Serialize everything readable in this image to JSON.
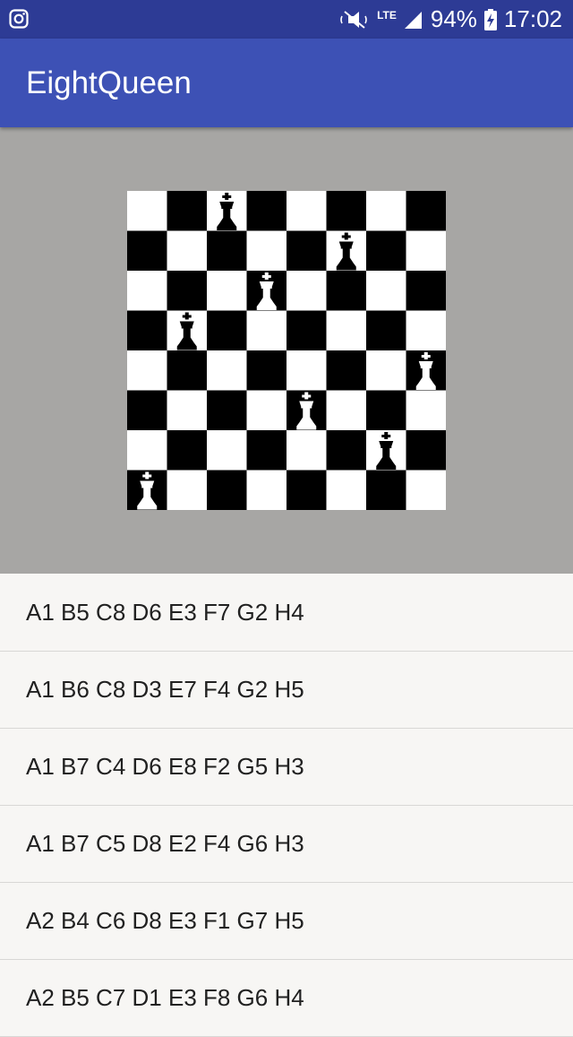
{
  "status_bar": {
    "battery": "94%",
    "time": "17:02",
    "network": "LTE",
    "icons": [
      "instagram-icon",
      "mute-icon",
      "signal-icon",
      "battery-charging-icon"
    ]
  },
  "app_bar": {
    "title": "EightQueen"
  },
  "board": {
    "size": 8,
    "queens": [
      {
        "col": 0,
        "row": 7,
        "color": "white"
      },
      {
        "col": 1,
        "row": 3,
        "color": "black"
      },
      {
        "col": 2,
        "row": 0,
        "color": "black"
      },
      {
        "col": 3,
        "row": 2,
        "color": "white"
      },
      {
        "col": 4,
        "row": 5,
        "color": "white"
      },
      {
        "col": 5,
        "row": 1,
        "color": "black"
      },
      {
        "col": 6,
        "row": 6,
        "color": "black"
      },
      {
        "col": 7,
        "row": 4,
        "color": "white"
      }
    ]
  },
  "solutions": [
    "A1 B5 C8 D6 E3 F7 G2 H4",
    "A1 B6 C8 D3 E7 F4 G2 H5",
    "A1 B7 C4 D6 E8 F2 G5 H3",
    "A1 B7 C5 D8 E2 F4 G6 H3",
    "A2 B4 C6 D8 E3 F1 G7 H5",
    "A2 B5 C7 D1 E3 F8 G6 H4"
  ],
  "colors": {
    "status_bar": "#2d3b95",
    "app_bar": "#3d51b5",
    "board_background": "#a7a6a4",
    "dark_square": "#000000",
    "light_square": "#ffffff"
  }
}
